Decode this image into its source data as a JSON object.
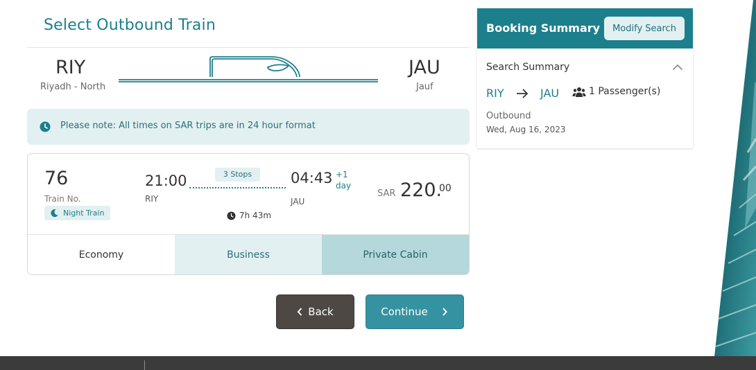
{
  "header": {
    "title": "Select Outbound Train"
  },
  "route": {
    "origin_code": "RIY",
    "origin_name": "Riyadh - North",
    "destination_code": "JAU",
    "destination_name": "Jauf"
  },
  "note": {
    "text": "Please note: All times on SAR trips are in 24 hour format",
    "icon": "clock-icon"
  },
  "train": {
    "number": "76",
    "number_label": "Train No.",
    "badge": "Night Train",
    "departure_time": "21:00",
    "departure_station": "RIY",
    "stops": "3 Stops",
    "duration": "7h 43m",
    "arrival_time": "04:43",
    "arrival_plus": "+1",
    "arrival_day": "day",
    "arrival_station": "JAU",
    "currency": "SAR",
    "price_whole": "220.",
    "price_decimal": "00",
    "classes": [
      "Economy",
      "Business",
      "Private Cabin"
    ]
  },
  "actions": {
    "back_label": "Back",
    "continue_label": "Continue"
  },
  "summary": {
    "title": "Booking Summary",
    "modify_label": "Modify Search",
    "section_title": "Search Summary",
    "from": "RIY",
    "to": "JAU",
    "passengers": "1 Passenger(s)",
    "direction": "Outbound",
    "date": "Wed, Aug 16, 2023"
  },
  "colors": {
    "accent": "#1c7f8c",
    "light_accent": "#e3f0f1",
    "button_dark": "#4d4844",
    "button_teal": "#3592a0"
  }
}
